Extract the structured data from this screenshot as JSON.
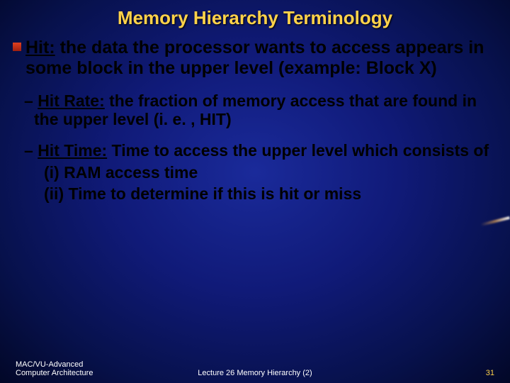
{
  "title": "Memory Hierarchy Terminology",
  "hit": {
    "term": "Hit:",
    "def": " the data the processor wants to access appears in some block in the upper level (example: Block X)"
  },
  "hit_rate": {
    "dash": "– ",
    "term": "Hit Rate:",
    "def": " the fraction of memory access that are found in the upper level (i. e. , HIT)"
  },
  "hit_time": {
    "dash": "– ",
    "term": "Hit Time:",
    "def": " Time to access the upper level which consists of"
  },
  "components": {
    "i": "(i) RAM access time",
    "ii": "(ii) Time to determine if this is hit or miss"
  },
  "footer": {
    "left1": "MAC/VU-Advanced",
    "left2": "Computer Architecture",
    "center": "Lecture 26 Memory Hierarchy (2)",
    "right": "31"
  }
}
